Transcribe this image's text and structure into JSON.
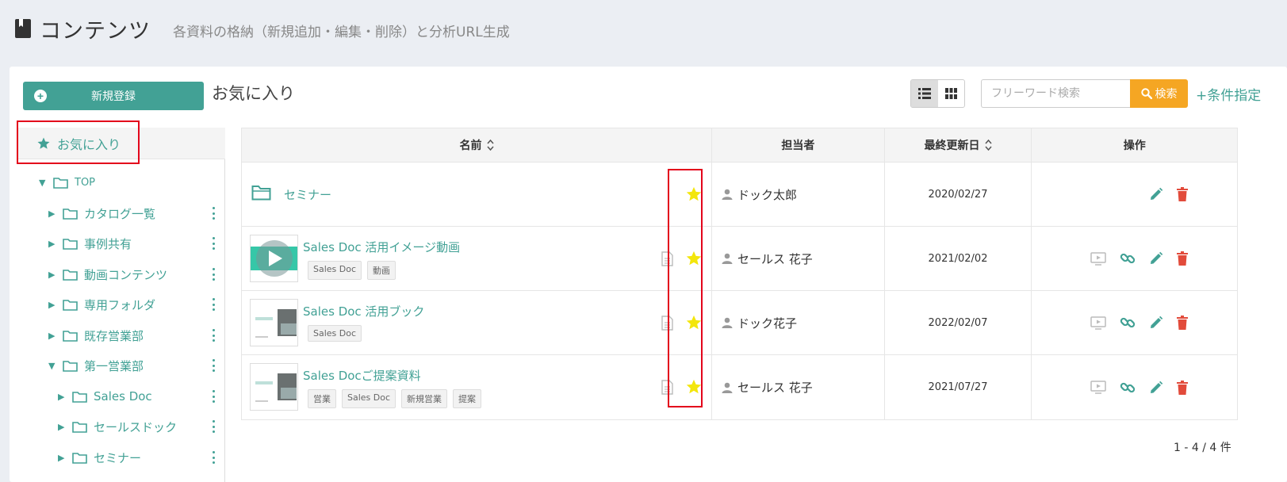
{
  "header": {
    "title": "コンテンツ",
    "subtitle": "各資料の格納（新規追加・編集・削除）と分析URL生成"
  },
  "toolbar": {
    "new_label": "新規登録",
    "section_title": "お気に入り",
    "search_placeholder": "フリーワード検索",
    "search_label": "検索",
    "condition_label": "+条件指定"
  },
  "sidebar": {
    "favorites_label": "お気に入り",
    "tree": [
      {
        "label": "TOP",
        "expanded": true
      },
      {
        "label": "カタログ一覧",
        "expanded": false
      },
      {
        "label": "事例共有",
        "expanded": false
      },
      {
        "label": "動画コンテンツ",
        "expanded": false
      },
      {
        "label": "専用フォルダ",
        "expanded": false
      },
      {
        "label": "既存営業部",
        "expanded": false
      },
      {
        "label": "第一営業部",
        "expanded": true
      },
      {
        "label": "Sales Doc",
        "expanded": false
      },
      {
        "label": "セールスドック",
        "expanded": false
      },
      {
        "label": "セミナー",
        "expanded": false
      }
    ]
  },
  "table": {
    "columns": [
      "名前",
      "担当者",
      "最終更新日",
      "操作"
    ],
    "rows": [
      {
        "name": "セミナー",
        "tags": [],
        "owner": "ドック太郎",
        "updated": "2020/02/27",
        "type": "folder",
        "favorite": true
      },
      {
        "name": "Sales Doc 活用イメージ動画",
        "tags": [
          "Sales Doc",
          "動画"
        ],
        "owner": "セールス 花子",
        "updated": "2021/02/02",
        "type": "video",
        "favorite": true
      },
      {
        "name": "Sales Doc 活用ブック",
        "tags": [
          "Sales Doc"
        ],
        "owner": "ドック花子",
        "updated": "2022/02/07",
        "type": "document",
        "favorite": true
      },
      {
        "name": "Sales Docご提案資料",
        "tags": [
          "営業",
          "Sales Doc",
          "新規営業",
          "提案"
        ],
        "owner": "セールス 花子",
        "updated": "2021/07/27",
        "type": "document",
        "favorite": true
      }
    ]
  },
  "pagination": {
    "summary": "1 - 4 / 4 件"
  },
  "colors": {
    "accent": "#42a195",
    "search": "#f5a623",
    "star": "#f3e60c",
    "delete": "#e24b3b",
    "highlight": "#e3001b"
  }
}
